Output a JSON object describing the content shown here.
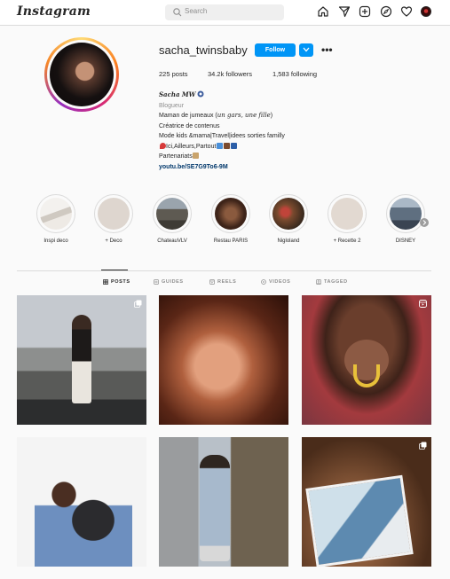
{
  "app": {
    "logo": "Instagram"
  },
  "search": {
    "placeholder": "Search"
  },
  "nav": {
    "icons": [
      "home-icon",
      "direct-icon",
      "new-post-icon",
      "explore-icon",
      "activity-heart-icon",
      "profile-avatar"
    ]
  },
  "profile": {
    "username": "sacha_twinsbaby",
    "follow_label": "Follow",
    "more_label": "•••",
    "stats": {
      "posts": "225 posts",
      "followers": "34.2k followers",
      "following": "1,583 following"
    },
    "bio": {
      "name": "Sacha MW",
      "category": "Blogueur",
      "line1_prefix": "Maman de jumeaux (",
      "line1_italic": "un gars, une fille",
      "line1_suffix": ")",
      "line2": "Créatrice de contenus",
      "line3": "Mode kids &mama|Travel|idees sorties familly",
      "line4": "Ici,Ailleurs,Partout",
      "line5": "Partenariats",
      "link": "youtu.be/SE7G9To6-9M"
    }
  },
  "highlights": [
    {
      "label": "Inspi deco",
      "color": "#e8e4e0"
    },
    {
      "label": "+ Deco",
      "color": "#ded6cf"
    },
    {
      "label": "ChateauVLV",
      "color": "#6d6a64"
    },
    {
      "label": "Restau PARIS",
      "color": "#4a2e22"
    },
    {
      "label": "Nigloland",
      "color": "#7a4a2e"
    },
    {
      "label": "+ Recette 2",
      "color": "#e2d9d1"
    },
    {
      "label": "DISNEY",
      "color": "#5f6f80"
    }
  ],
  "tabs": [
    {
      "label": "POSTS",
      "icon": "grid-icon",
      "active": true
    },
    {
      "label": "GUIDES",
      "icon": "guides-icon",
      "active": false
    },
    {
      "label": "REELS",
      "icon": "reels-icon",
      "active": false
    },
    {
      "label": "VIDEOS",
      "icon": "videos-icon",
      "active": false
    },
    {
      "label": "TAGGED",
      "icon": "tagged-icon",
      "active": false
    }
  ],
  "posts": [
    {
      "badge": "carousel-icon"
    },
    {
      "badge": ""
    },
    {
      "badge": "reel-icon"
    },
    {
      "badge": ""
    },
    {
      "badge": ""
    },
    {
      "badge": "carousel-icon"
    }
  ]
}
